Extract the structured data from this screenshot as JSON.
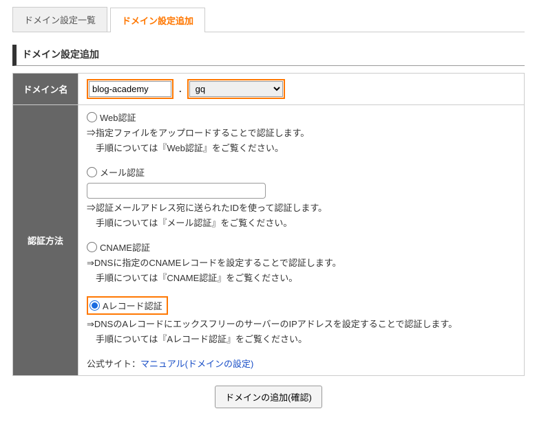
{
  "tabs": {
    "list": "ドメイン設定一覧",
    "add": "ドメイン設定追加"
  },
  "section_title": "ドメイン設定追加",
  "row_domain": {
    "label": "ドメイン名",
    "value": "blog-academy",
    "dot": ".",
    "tld": "gq"
  },
  "row_auth": {
    "label": "認証方法",
    "web": {
      "title": "Web認証",
      "line1": "⇒指定ファイルをアップロードすることで認証します。",
      "line2": "　手順については『Web認証』をご覧ください。"
    },
    "mail": {
      "title": "メール認証",
      "input_value": "",
      "line1": "⇒認証メールアドレス宛に送られたIDを使って認証します。",
      "line2": "　手順については『メール認証』をご覧ください。"
    },
    "cname": {
      "title": "CNAME認証",
      "line1": "⇒DNSに指定のCNAMEレコードを設定することで認証します。",
      "line2": "　手順については『CNAME認証』をご覧ください。"
    },
    "arec": {
      "title": "Aレコード認証",
      "line1": "⇒DNSのAレコードにエックスフリーのサーバーのIPアドレスを設定することで認証します。",
      "line2": "　手順については『Aレコード認証』をご覧ください。"
    },
    "official_label": "公式サイト：",
    "official_link": "マニュアル(ドメインの設定)"
  },
  "submit": "ドメインの追加(確認)"
}
